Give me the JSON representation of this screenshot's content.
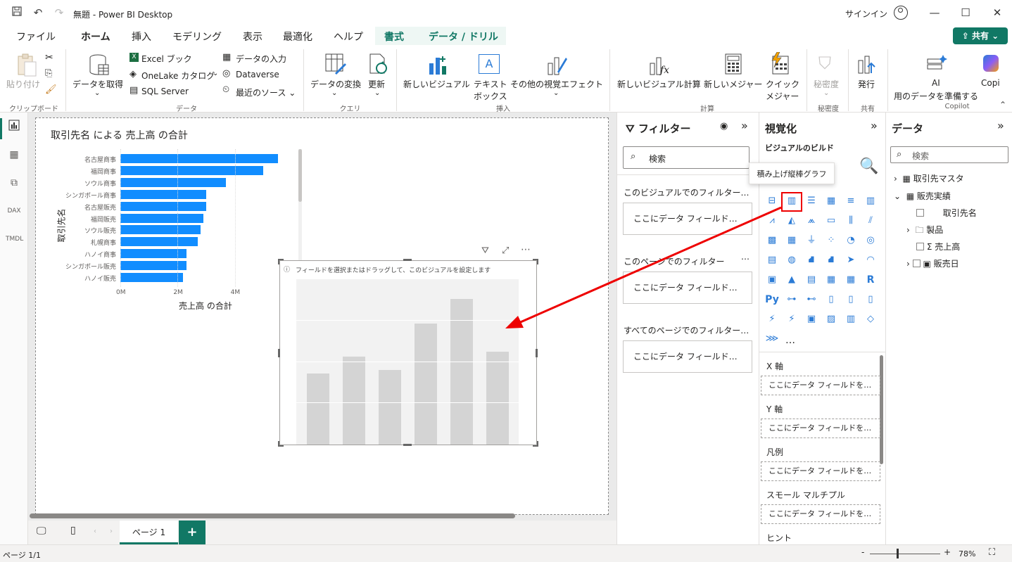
{
  "window": {
    "title": "無題 - Power BI Desktop",
    "signin": "サインイン"
  },
  "tabs": [
    {
      "label": "ファイル"
    },
    {
      "label": "ホーム"
    },
    {
      "label": "挿入"
    },
    {
      "label": "モデリング"
    },
    {
      "label": "表示"
    },
    {
      "label": "最適化"
    },
    {
      "label": "ヘルプ"
    },
    {
      "label": "書式"
    },
    {
      "label": "データ / ドリル"
    }
  ],
  "share": "共有",
  "ribbon": {
    "paste": "貼り付け",
    "clipboard_group": "クリップボード",
    "get_data": "データを取得",
    "excel": "Excel ブック",
    "onelake": "OneLake カタログ",
    "sql": "SQL Server",
    "enter_data": "データの入力",
    "dataverse": "Dataverse",
    "recent": "最近のソース",
    "data_group": "データ",
    "transform": "データの変換",
    "refresh": "更新",
    "query_group": "クエリ",
    "new_visual": "新しいビジュアル",
    "textbox_1": "テキスト",
    "textbox_2": "ボックス",
    "more_visuals": "その他の視覚エフェクト",
    "insert_group": "挿入",
    "new_visual_calc": "新しいビジュアル計算",
    "new_measure": "新しいメジャー",
    "quick_measure_1": "クイック",
    "quick_measure_2": "メジャー",
    "calc_group": "計算",
    "sensitivity": "秘密度",
    "sensitivity_group": "秘密度",
    "publish": "発行",
    "share_group": "共有",
    "ai_1": "AI",
    "ai_2": "用のデータを準備する",
    "copilot": "Copi",
    "copilot_group": "Copilot"
  },
  "chart_data": {
    "type": "bar",
    "title": "取引先名 による 売上高 の合計",
    "ylabel": "取引先名",
    "xlabel": "売上高 の合計",
    "categories": [
      "名古屋商事",
      "福岡商事",
      "ソウル商事",
      "シンガポール商事",
      "名古屋販売",
      "福岡販売",
      "ソウル販売",
      "札幌商事",
      "ハノイ商事",
      "シンガポール販売",
      "ハノイ販売"
    ],
    "values": [
      5.5,
      5.0,
      3.7,
      3.0,
      3.0,
      2.9,
      2.8,
      2.7,
      2.3,
      2.3,
      2.2
    ],
    "xticks": [
      "0M",
      "2M",
      "4M"
    ],
    "xlim": [
      0,
      6
    ]
  },
  "placeholder_visual": {
    "hint": "フィールドを選択またはドラッグして、このビジュアルを設定します",
    "bars": [
      0.43,
      0.53,
      0.45,
      0.73,
      0.88,
      0.56
    ]
  },
  "filters": {
    "title": "フィルター",
    "search": "検索",
    "visual_label": "このビジュアルでのフィルター…",
    "page_label": "このページでのフィルター",
    "all_label": "すべてのページでのフィルター…",
    "drop": "ここにデータ フィールド…"
  },
  "viz": {
    "title": "視覚化",
    "build": "ビジュアルのビルド",
    "tooltip": "積み上げ縦棒グラフ",
    "wells": [
      {
        "label": "X 軸",
        "drop": "ここにデータ フィールドを…"
      },
      {
        "label": "Y 軸",
        "drop": "ここにデータ フィールドを…"
      },
      {
        "label": "凡例",
        "drop": "ここにデータ フィールドを…"
      },
      {
        "label": "スモール マルチプル",
        "drop": "ここにデータ フィールドを…"
      }
    ],
    "hint_label": "ヒント",
    "more": "…"
  },
  "data": {
    "title": "データ",
    "search": "検索",
    "tables": [
      {
        "name": "取引先マスタ"
      },
      {
        "name": "販売実績"
      }
    ],
    "fields": [
      {
        "name": "取引先名"
      },
      {
        "name": "製品"
      },
      {
        "name": "売上高"
      },
      {
        "name": "販売日"
      }
    ]
  },
  "pages": {
    "page1": "ページ 1"
  },
  "status": {
    "page_info": "ページ 1/1",
    "zoom": "78%"
  }
}
